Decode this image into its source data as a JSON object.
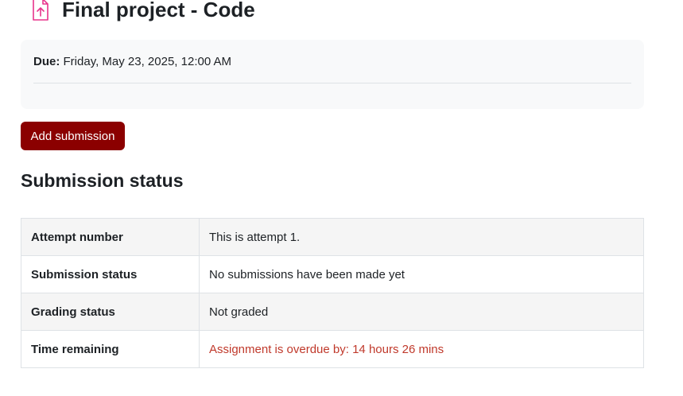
{
  "page": {
    "title": "Final project - Code",
    "icon": "assignment-upload-icon"
  },
  "dates": {
    "due_label": "Due:",
    "due_value": "Friday, May 23, 2025, 12:00 AM"
  },
  "actions": {
    "add_submission_label": "Add submission"
  },
  "submission_status": {
    "heading": "Submission status",
    "rows": [
      {
        "label": "Attempt number",
        "value": "This is attempt 1."
      },
      {
        "label": "Submission status",
        "value": "No submissions have been made yet"
      },
      {
        "label": "Grading status",
        "value": "Not graded"
      },
      {
        "label": "Time remaining",
        "value": "Assignment is overdue by: 14 hours 26 mins"
      }
    ]
  },
  "colors": {
    "icon": "#e8338c",
    "primary_button": "#8b0000",
    "overdue_text": "#c0392b"
  }
}
